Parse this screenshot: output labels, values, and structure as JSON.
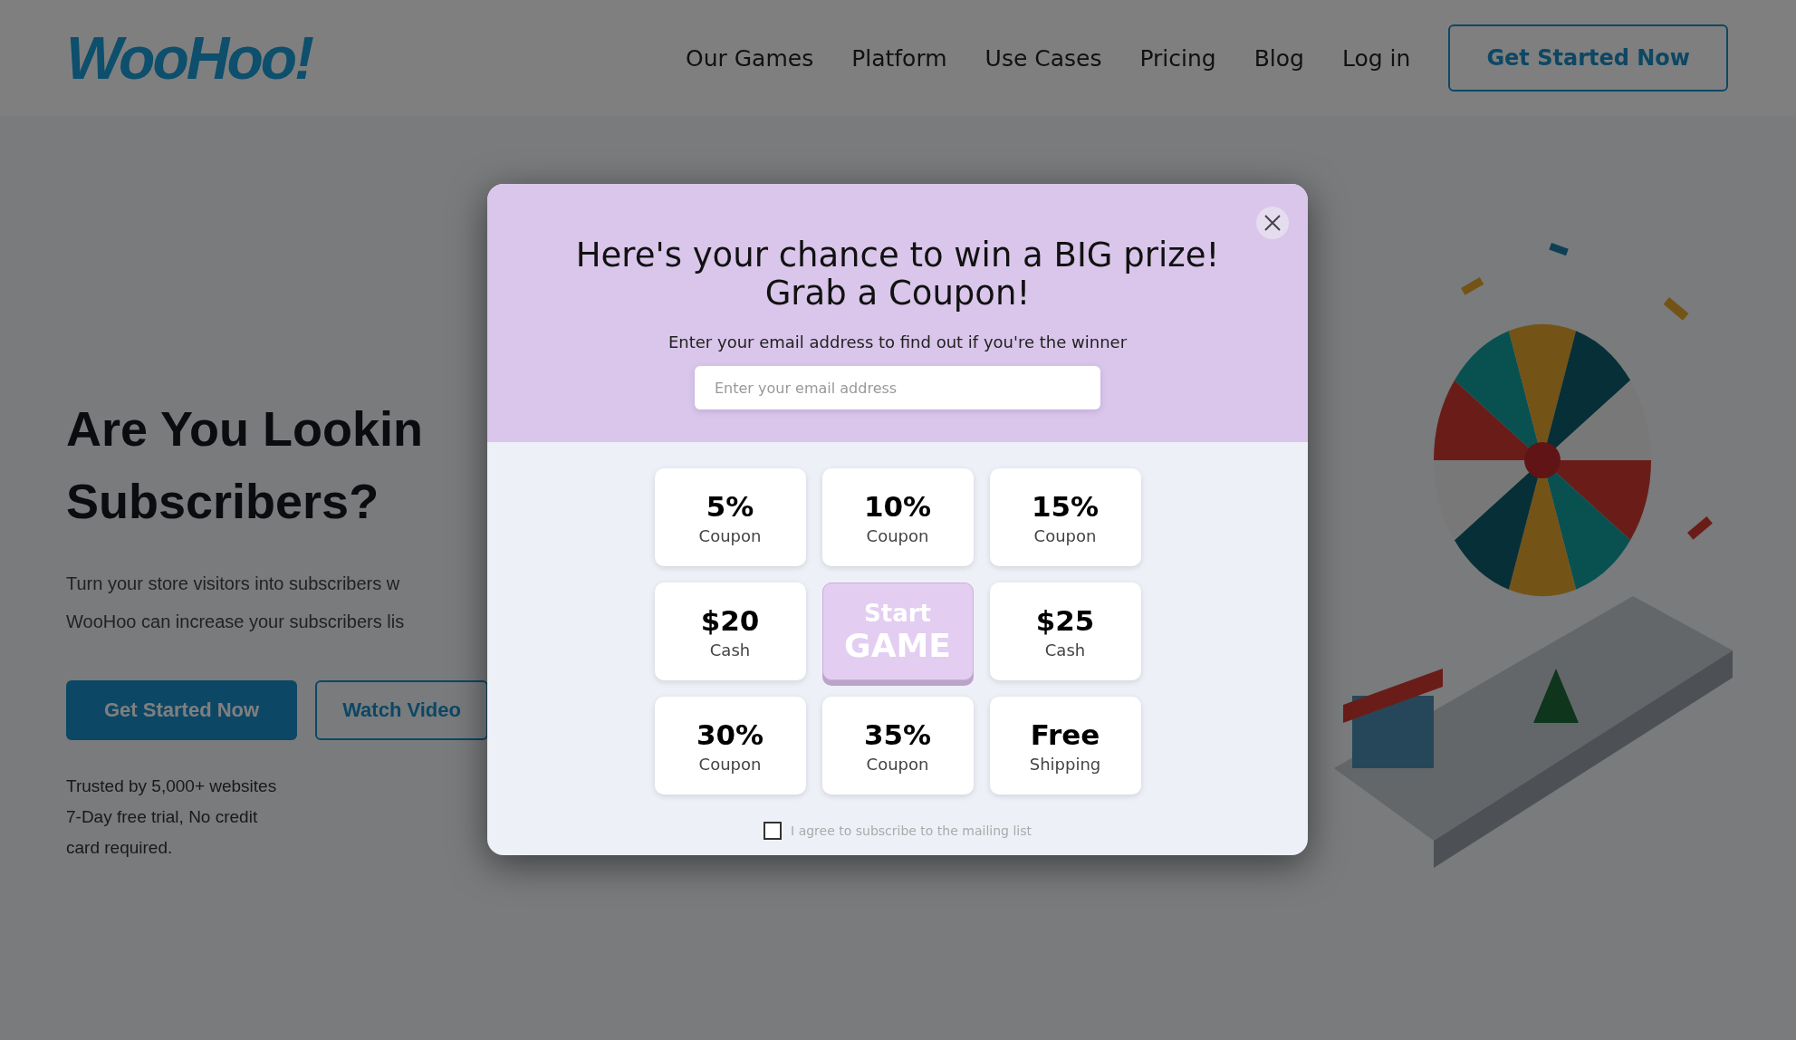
{
  "header": {
    "logo": "WooHoo!",
    "nav": [
      "Our Games",
      "Platform",
      "Use Cases",
      "Pricing",
      "Blog",
      "Log in"
    ],
    "cta": "Get Started Now"
  },
  "hero": {
    "heading_lines": [
      "Are You Lookin",
      "Subscribers?"
    ],
    "description_lines": [
      "Turn your store visitors into subscribers w",
      "WooHoo can increase your subscribers lis"
    ],
    "primary_button": "Get Started Now",
    "secondary_button": "Watch Video",
    "notes": [
      "Trusted by 5,000+ websites",
      "7-Day free trial, No credit",
      "card required."
    ]
  },
  "popup": {
    "title": "Here's your chance to win a BIG prize! Grab a Coupon!",
    "subtitle": "Enter your email address to find out if you're the winner",
    "email": {
      "placeholder": "Enter your email address"
    },
    "cells": [
      {
        "kind": "prize",
        "value": "5%",
        "label": "Coupon"
      },
      {
        "kind": "prize",
        "value": "10%",
        "label": "Coupon"
      },
      {
        "kind": "prize",
        "value": "15%",
        "label": "Coupon"
      },
      {
        "kind": "prize",
        "value": "$20",
        "label": "Cash"
      },
      {
        "kind": "start",
        "value": "Start",
        "label": "GAME"
      },
      {
        "kind": "prize",
        "value": "$25",
        "label": "Cash"
      },
      {
        "kind": "prize",
        "value": "30%",
        "label": "Coupon"
      },
      {
        "kind": "prize",
        "value": "35%",
        "label": "Coupon"
      },
      {
        "kind": "prize",
        "value": "Free",
        "label": "Shipping"
      }
    ],
    "consent": {
      "label": "I agree to subscribe to the mailing list",
      "checked": false
    }
  }
}
